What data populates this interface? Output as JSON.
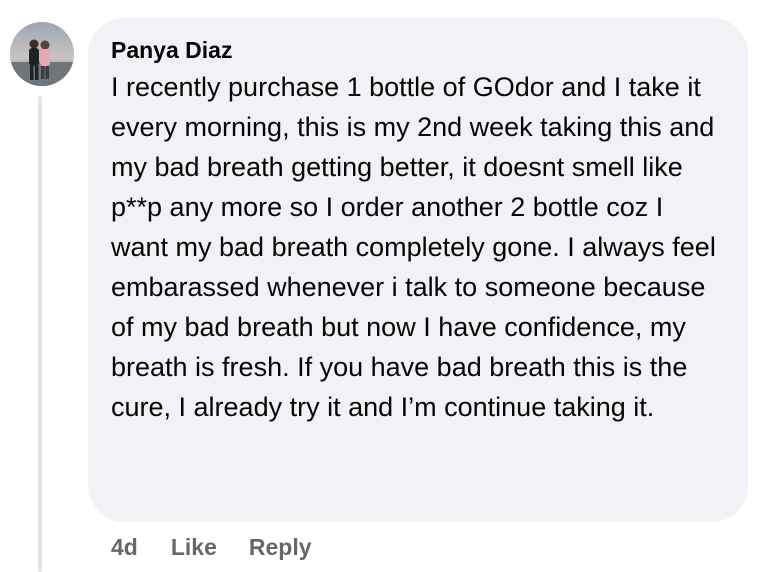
{
  "comment": {
    "author": "Panya Diaz",
    "text": "I recently purchase 1 bottle of GOdor and I take it every morning, this is my 2nd week taking this and my bad breath getting better, it doesnt smell like p**p any more so I order another 2 bottle coz I want my bad breath completely gone. I always feel embarassed whenever i talk to someone because of my bad breath but now I have confidence, my breath is fresh. If you have bad breath this is the cure, I already try it and I’m continue taking it.",
    "timestamp": "4d",
    "like_label": "Like",
    "reply_label": "Reply"
  },
  "colors": {
    "bubble_background": "#f0f2f5",
    "text_primary": "#050505",
    "text_secondary": "#65676b",
    "thread_line": "#e4e6eb"
  },
  "icons": {
    "avatar": "profile-photo-avatar"
  }
}
